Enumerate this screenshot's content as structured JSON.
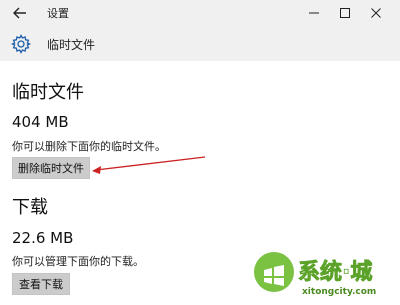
{
  "window": {
    "title": "设置",
    "controls": [
      "minimize",
      "maximize",
      "close"
    ]
  },
  "page": {
    "title": "临时文件"
  },
  "temp_section": {
    "heading": "临时文件",
    "size": "404 MB",
    "description": "你可以删除下面你的临时文件。",
    "button_label": "删除临时文件"
  },
  "download_section": {
    "heading": "下载",
    "size": "22.6 MB",
    "description": "你可以管理下面你的下载。",
    "button_label": "查看下载"
  },
  "watermark": {
    "text": "系统城",
    "subtext": "xitongcity.com"
  },
  "annotation_color": "#cc2222"
}
